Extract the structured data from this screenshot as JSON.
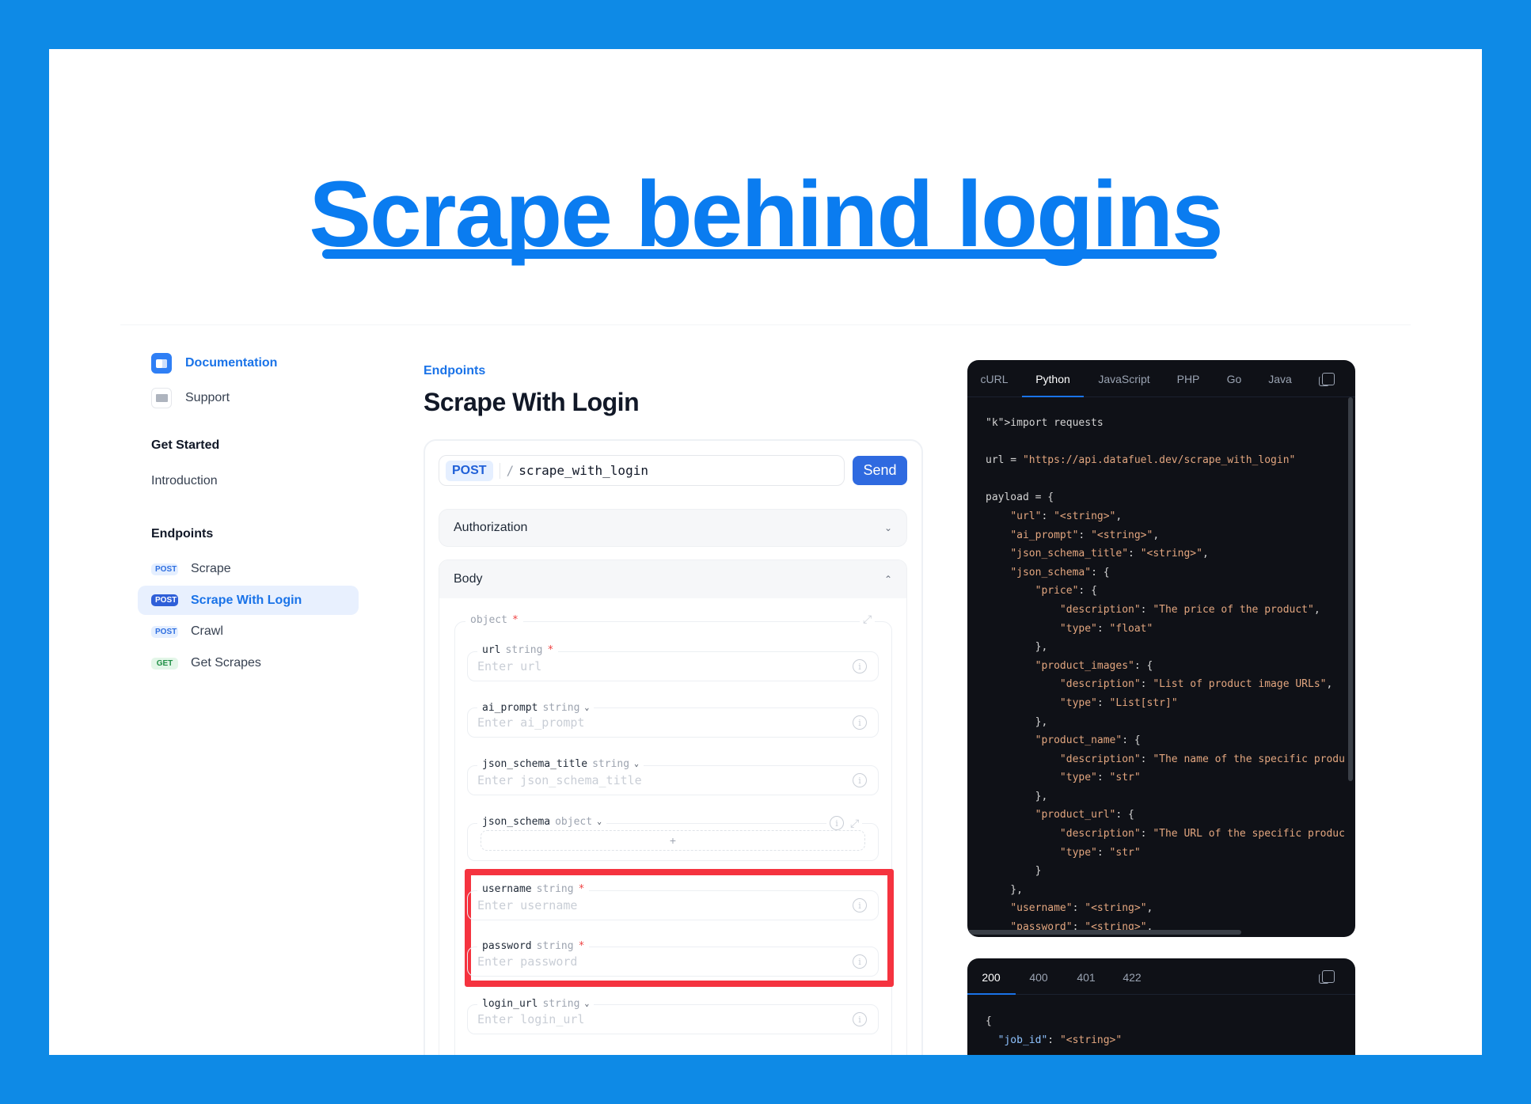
{
  "hero": {
    "title": "Scrape behind logins"
  },
  "sidebar": {
    "top": [
      {
        "label": "Documentation",
        "icon": "book-icon"
      },
      {
        "label": "Support",
        "icon": "envelope-icon"
      }
    ],
    "get_started": {
      "heading": "Get Started",
      "items": [
        "Introduction"
      ]
    },
    "endpoints": {
      "heading": "Endpoints",
      "items": [
        {
          "method": "POST",
          "label": "Scrape"
        },
        {
          "method": "POST",
          "label": "Scrape With Login",
          "selected": true
        },
        {
          "method": "POST",
          "label": "Crawl"
        },
        {
          "method": "GET",
          "label": "Get Scrapes"
        }
      ]
    }
  },
  "main": {
    "breadcrumb": "Endpoints",
    "title": "Scrape With Login",
    "request": {
      "method": "POST",
      "separator": "/",
      "path": "scrape_with_login",
      "send": "Send"
    },
    "authorization": "Authorization",
    "body": "Body",
    "root": {
      "name": "object",
      "required": "*"
    },
    "fields": [
      {
        "name": "url",
        "type": "string",
        "required": "*",
        "placeholder": "Enter url"
      },
      {
        "name": "ai_prompt",
        "type": "string",
        "placeholder": "Enter ai_prompt"
      },
      {
        "name": "json_schema_title",
        "type": "string",
        "placeholder": "Enter json_schema_title"
      },
      {
        "name": "json_schema",
        "type": "object",
        "add": "+"
      },
      {
        "name": "username",
        "type": "string",
        "required": "*",
        "placeholder": "Enter username"
      },
      {
        "name": "password",
        "type": "string",
        "required": "*",
        "placeholder": "Enter password"
      },
      {
        "name": "login_url",
        "type": "string",
        "placeholder": "Enter login_url"
      }
    ],
    "highlight_color": "#f5333f"
  },
  "code": {
    "tabs": [
      "cURL",
      "Python",
      "JavaScript",
      "PHP",
      "Go",
      "Java"
    ],
    "active_tab": "Python",
    "lines": [
      "import requests",
      "",
      "url = \"https://api.datafuel.dev/scrape_with_login\"",
      "",
      "payload = {",
      "    \"url\": \"<string>\",",
      "    \"ai_prompt\": \"<string>\",",
      "    \"json_schema_title\": \"<string>\",",
      "    \"json_schema\": {",
      "        \"price\": {",
      "            \"description\": \"The price of the product\",",
      "            \"type\": \"float\"",
      "        },",
      "        \"product_images\": {",
      "            \"description\": \"List of product image URLs\",",
      "            \"type\": \"List[str]\"",
      "        },",
      "        \"product_name\": {",
      "            \"description\": \"The name of the specific produc",
      "            \"type\": \"str\"",
      "        },",
      "        \"product_url\": {",
      "            \"description\": \"The URL of the specific product",
      "            \"type\": \"str\"",
      "        }",
      "    },",
      "    \"username\": \"<string>\",",
      "    \"password\": \"<string>\","
    ]
  },
  "response": {
    "tabs": [
      "200",
      "400",
      "401",
      "422"
    ],
    "active_tab": "200",
    "lines": [
      "{",
      "  \"job_id\": \"<string>\""
    ]
  },
  "colors": {
    "background": "#0e8ae6",
    "accent": "#0a7cf0",
    "code_bg": "#0f1117",
    "string": "#e3a67f"
  }
}
